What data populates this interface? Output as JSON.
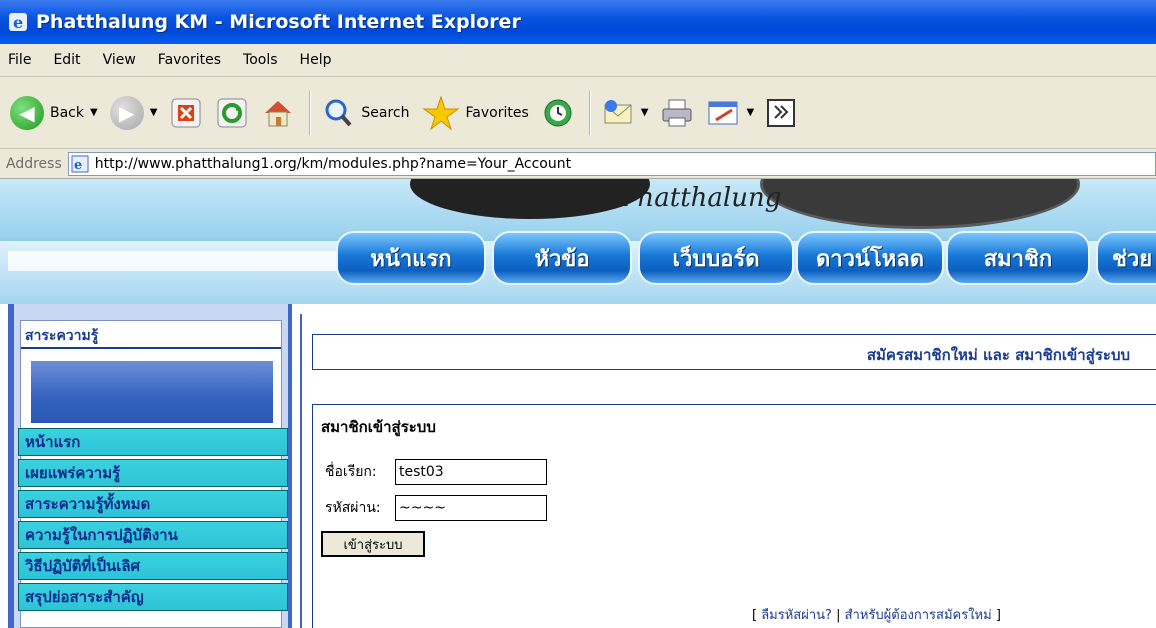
{
  "window": {
    "title": "Phatthalung KM - Microsoft Internet Explorer"
  },
  "menubar": {
    "items": [
      "File",
      "Edit",
      "View",
      "Favorites",
      "Tools",
      "Help"
    ]
  },
  "toolbar": {
    "back_label": "Back",
    "search_label": "Search",
    "favorites_label": "Favorites"
  },
  "addressbar": {
    "label": "Address",
    "url": "http://www.phatthalung1.org/km/modules.php?name=Your_Account"
  },
  "banner": {
    "logo_text": "Phatthalung",
    "nav_tabs": [
      "หน้าแรก",
      "หัวข้อ",
      "เว็บบอร์ด",
      "ดาวน์โหลด",
      "สมาชิก",
      "ช่วย"
    ]
  },
  "sidebar": {
    "title": "สาระความรู้",
    "items": [
      "หน้าแรก",
      "เผยแพร่ความรู้",
      "สาระความรู้ทั้งหมด",
      "ความรู้ในการปฏิบัติงาน",
      "วิธีปฏิบัติที่เป็นเลิศ",
      "สรุปย่อสาระสำคัญ"
    ]
  },
  "main": {
    "register_heading": "สมัครสมาชิกใหม่ และ สมาชิกเข้าสู่ระบบ",
    "login_heading": "สมาชิกเข้าสู่ระบบ",
    "username_label": "ชื่อเรียก:",
    "username_value": "test03",
    "password_label": "รหัสผ่าน:",
    "password_value": "~~~~",
    "login_button": "เข้าสู่ระบบ",
    "links": {
      "open": "[",
      "forgot": "ลืมรหัสผ่าน?",
      "sep": "|",
      "register": "สำหรับผู้ต้องการสมัครใหม่",
      "close": "]"
    }
  }
}
